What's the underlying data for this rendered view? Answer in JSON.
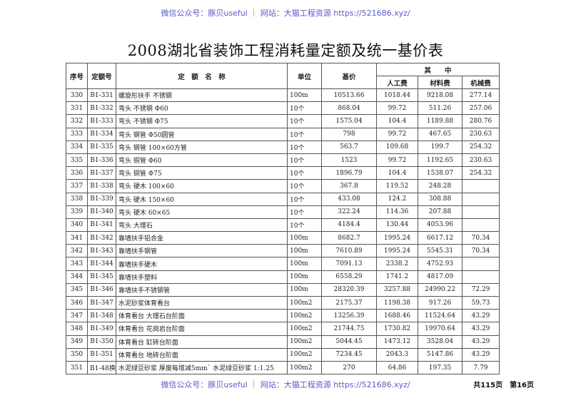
{
  "watermark": "微信公众号：豚贝useful ｜ 网站：大猫工程资源 https://521686.xyz/",
  "title": "2008湖北省装饰工程消耗量定额及统一基价表",
  "headers": {
    "no": "序号",
    "code": "定额号",
    "name": "定　额　名　称",
    "unit": "单位",
    "base_price": "基价",
    "group": "其　　中",
    "labor": "人工费",
    "material": "材料费",
    "machine": "机械费"
  },
  "rows": [
    [
      "330",
      "B1-331",
      "螺旋形扶手 不锈钢",
      "100m",
      "10513.66",
      "1018.44",
      "9218.08",
      "277.14"
    ],
    [
      "331",
      "B1-332",
      "弯头 不锈钢 Φ60",
      "10个",
      "868.04",
      "99.72",
      "511.26",
      "257.06"
    ],
    [
      "332",
      "B1-333",
      "弯头 不锈钢 Φ75",
      "10个",
      "1575.04",
      "104.4",
      "1189.88",
      "280.76"
    ],
    [
      "333",
      "B1-334",
      "弯头 钢管 Φ50圆管",
      "10个",
      "798",
      "99.72",
      "467.65",
      "230.63"
    ],
    [
      "334",
      "B1-335",
      "弯头 钢管 100×60方管",
      "10个",
      "563.7",
      "109.68",
      "199.7",
      "254.32"
    ],
    [
      "335",
      "B1-336",
      "弯头 铜管 Φ60",
      "10个",
      "1523",
      "99.72",
      "1192.65",
      "230.63"
    ],
    [
      "336",
      "B1-337",
      "弯头 铜管 Φ75",
      "10个",
      "1896.79",
      "104.4",
      "1538.07",
      "254.32"
    ],
    [
      "337",
      "B1-338",
      "弯头 硬木 100×60",
      "10个",
      "367.8",
      "119.52",
      "248.28",
      ""
    ],
    [
      "338",
      "B1-339",
      "弯头 硬木 150×60",
      "10个",
      "433.08",
      "124.2",
      "308.88",
      ""
    ],
    [
      "339",
      "B1-340",
      "弯头 硬木 60×65",
      "10个",
      "322.24",
      "114.36",
      "207.88",
      ""
    ],
    [
      "340",
      "B1-341",
      "弯头 大理石",
      "10个",
      "4184.4",
      "130.44",
      "4053.96",
      ""
    ],
    [
      "341",
      "B1-342",
      "靠墙扶手铝合金",
      "100m",
      "8682.7",
      "1995.24",
      "6617.12",
      "70.34"
    ],
    [
      "342",
      "B1-343",
      "靠墙扶手钢管",
      "100m",
      "7610.89",
      "1995.24",
      "5545.31",
      "70.34"
    ],
    [
      "343",
      "B1-344",
      "靠墙扶手硬木",
      "100m",
      "7091.13",
      "2338.2",
      "4752.93",
      ""
    ],
    [
      "344",
      "B1-345",
      "靠墙扶手塑料",
      "100m",
      "6558.29",
      "1741.2",
      "4817.09",
      ""
    ],
    [
      "345",
      "B1-346",
      "靠墙扶手不锈钢管",
      "100m",
      "28320.39",
      "3257.88",
      "24990.22",
      "72.29"
    ],
    [
      "346",
      "B1-347",
      "水泥砂浆体育看台",
      "100m2",
      "2175.37",
      "1198.38",
      "917.26",
      "59.73"
    ],
    [
      "347",
      "B1-348",
      "体育看台 大理石台阶面",
      "100m2",
      "13256.39",
      "1688.46",
      "11524.64",
      "43.29"
    ],
    [
      "348",
      "B1-349",
      "体育看台 花岗岩台阶面",
      "100m2",
      "21744.75",
      "1730.82",
      "19970.64",
      "43.29"
    ],
    [
      "349",
      "B1-350",
      "体育看台 缸砖台阶面",
      "100m2",
      "5044.45",
      "1473.12",
      "3528.04",
      "43.29"
    ],
    [
      "350",
      "B1-351",
      "体育看台 地砖台阶面",
      "100m2",
      "7234.45",
      "2043.3",
      "5147.86",
      "43.29"
    ],
    [
      "351",
      "B1-48换",
      "水泥绿豆砂浆 厚度每增减5mm` 水泥绿豆砂浆 1:1.25",
      "100m2",
      "270",
      "64.86",
      "197.35",
      "7.79"
    ]
  ],
  "page_info": "共115页　第16页"
}
